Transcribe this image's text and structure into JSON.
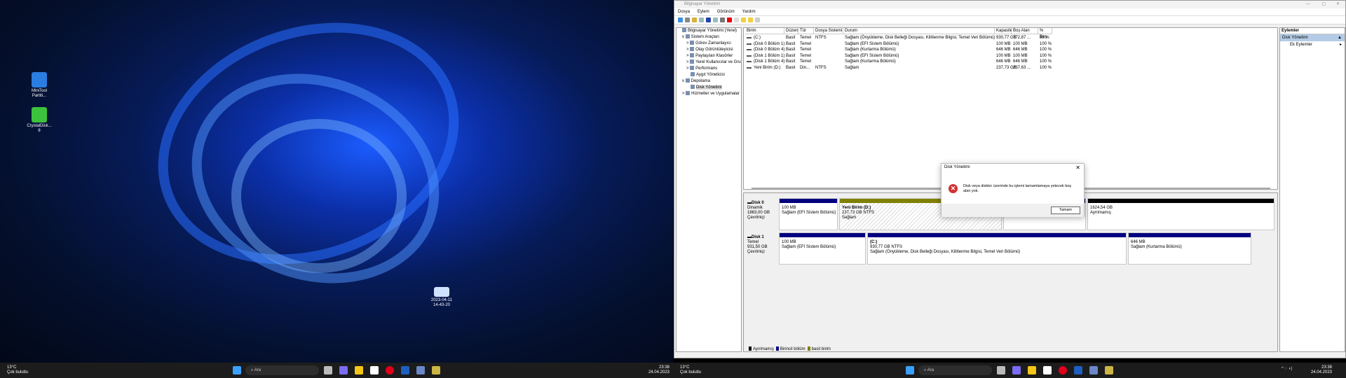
{
  "desktop": {
    "icons": [
      {
        "label": "MiniTool Partiti...",
        "color": "#2a7de1"
      },
      {
        "label": "CrystalDisk... 8",
        "color": "#3cc23c"
      },
      {
        "label": "2023-04-11 14-43-20",
        "color": "#cfe3ff"
      }
    ]
  },
  "taskbar_left": {
    "weather_temp": "13°C",
    "weather_desc": "Çok bulutlu",
    "search": "Ara",
    "time": "23:38",
    "date": "24.04.2023"
  },
  "taskbar_right": {
    "weather_temp": "13°C",
    "weather_desc": "Çok bulutlu",
    "search": "Ara",
    "time": "23:38",
    "date": "24.04.2023"
  },
  "window": {
    "title": "Bilgisayar Yönetimi",
    "menu": [
      "Dosya",
      "Eylem",
      "Görünüm",
      "Yardım"
    ]
  },
  "tree": [
    {
      "label": "Bilgisayar Yönetimi (Yerel)",
      "indent": 0
    },
    {
      "label": "Sistem Araçları",
      "indent": 1,
      "exp": "v"
    },
    {
      "label": "Görev Zamanlayıcı",
      "indent": 2,
      "exp": ">"
    },
    {
      "label": "Olay Görüntüleyicisi",
      "indent": 2,
      "exp": ">"
    },
    {
      "label": "Paylaşılan Klasörler",
      "indent": 2,
      "exp": ">"
    },
    {
      "label": "Yerel Kullanıcılar ve Gru",
      "indent": 2,
      "exp": ">"
    },
    {
      "label": "Performans",
      "indent": 2,
      "exp": ">"
    },
    {
      "label": "Aygıt Yöneticisi",
      "indent": 2
    },
    {
      "label": "Depolama",
      "indent": 1,
      "exp": "v"
    },
    {
      "label": "Disk Yönetimi",
      "indent": 2,
      "selected": true
    },
    {
      "label": "Hizmetler ve Uygulamalar",
      "indent": 1,
      "exp": ">"
    }
  ],
  "volume_table": {
    "columns": [
      "Birim",
      "Düzen",
      "Tür",
      "Dosya Sistemi",
      "Durum",
      "Kapasite",
      "Boş Alan",
      "% Boş"
    ],
    "rows": [
      [
        "(C:)",
        "Basit",
        "Temel",
        "NTFS",
        "Sağlam (Önyükleme, Disk Belleği Dosyası, Kilitlenme Bilgisi, Temel Veri Bölümü)",
        "930,77 GB",
        "772,87 ...",
        "83 %"
      ],
      [
        "(Disk 0 Bölüm 1)",
        "Basit",
        "Temel",
        "",
        "Sağlam (EFI Sistem Bölümü)",
        "100 MB",
        "100 MB",
        "100 %"
      ],
      [
        "(Disk 0 Bölüm 4)",
        "Basit",
        "Temel",
        "",
        "Sağlam (Kurtarma Bölümü)",
        "646 MB",
        "646 MB",
        "100 %"
      ],
      [
        "(Disk 1 Bölüm 1)",
        "Basit",
        "Temel",
        "",
        "Sağlam (EFI Sistem Bölümü)",
        "100 MB",
        "100 MB",
        "100 %"
      ],
      [
        "(Disk 1 Bölüm 4)",
        "Basit",
        "Temel",
        "",
        "Sağlam (Kurtarma Bölümü)",
        "646 MB",
        "646 MB",
        "100 %"
      ],
      [
        "Yeni Birim (D:)",
        "Basit",
        "Din...",
        "NTFS",
        "Sağlam",
        "237,73 GB",
        "237,63 ...",
        "100 %"
      ]
    ]
  },
  "disks": [
    {
      "name": "Disk 0",
      "type": "Dinamik",
      "size": "1863,00 GB",
      "state": "Çevrimiçi",
      "partitions": [
        {
          "title": "",
          "l1": "100 MB",
          "l2": "Sağlam (EFI Sistem Bölümü)",
          "color": "#000080"
        },
        {
          "title": "Yeni Birim  (D:)",
          "l1": "237,73 GB NTFS",
          "l2": "Sağlam",
          "color": "#808000",
          "hatch": true
        },
        {
          "title": "",
          "l1": "",
          "l2": "Sağlam (Kurtarma Bölümü)",
          "color": "#000080"
        },
        {
          "title": "",
          "l1": "1624,54 GB",
          "l2": "Ayrılmamış",
          "color": "#000000"
        }
      ]
    },
    {
      "name": "Disk 1",
      "type": "Temel",
      "size": "931,50 GB",
      "state": "Çevrimiçi",
      "partitions": [
        {
          "title": "",
          "l1": "100 MB",
          "l2": "Sağlam (EFI Sistem Bölümü)",
          "color": "#000080"
        },
        {
          "title": "(C:)",
          "l1": "930,77 GB NTFS",
          "l2": "Sağlam (Önyükleme, Disk Belleği Dosyası, Kilitlenme Bilgisi, Temel Veri Bölümü)",
          "color": "#000080"
        },
        {
          "title": "",
          "l1": "646 MB",
          "l2": "Sağlam (Kurtarma Bölümü)",
          "color": "#000080"
        }
      ]
    }
  ],
  "legend": [
    {
      "label": "Ayrılmamış",
      "color": "#000000"
    },
    {
      "label": "Birincil bölüm",
      "color": "#000080"
    },
    {
      "label": "basit birim",
      "color": "#808000"
    }
  ],
  "actions": {
    "header": "Eylemler",
    "section": "Disk Yönetimi",
    "item": "Ek Eylemler"
  },
  "dialog": {
    "title": "Disk Yönetimi",
    "message": "Disk veya diskler üzerinde bu işlemi tamamlamaya yetecek boş alan yok.",
    "ok": "Tamam",
    "icon": "error-icon"
  }
}
